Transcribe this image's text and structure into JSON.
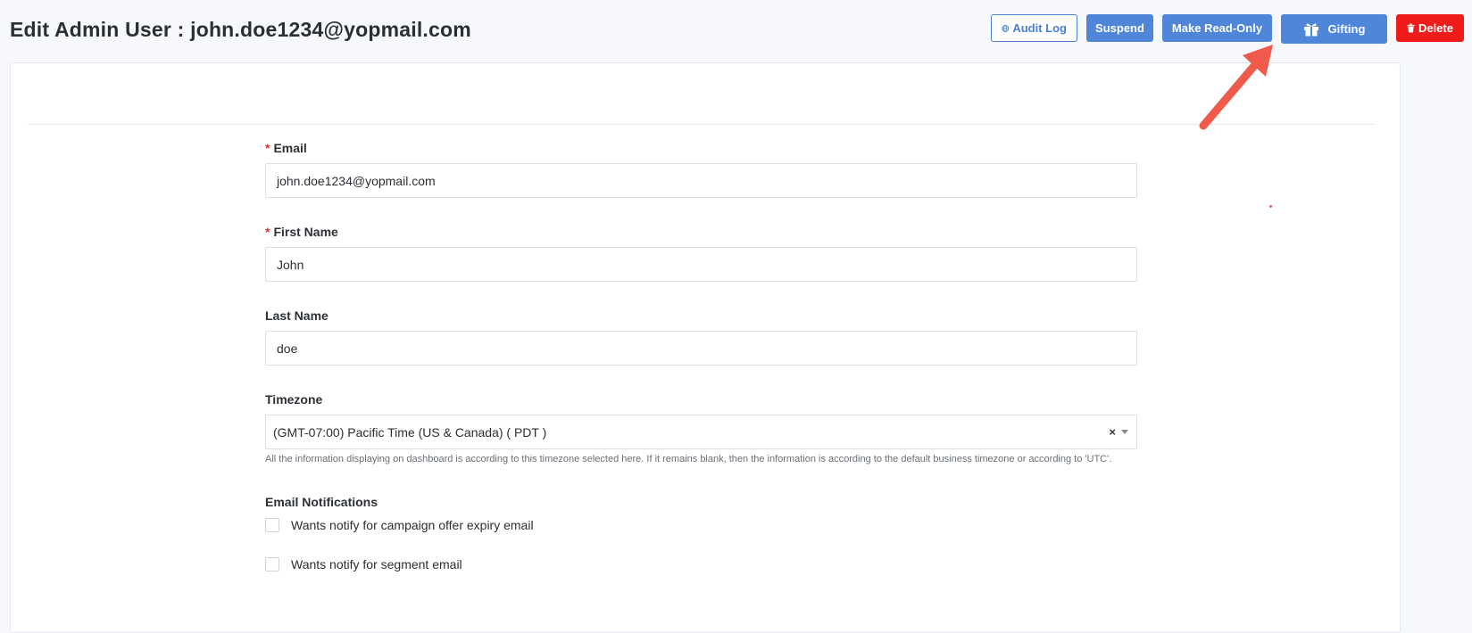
{
  "header": {
    "title": "Edit Admin User : john.doe1234@yopmail.com",
    "buttons": {
      "audit_log": "Audit Log",
      "suspend": "Suspend",
      "read_only": "Make Read-Only",
      "gifting": "Gifting",
      "delete": "Delete"
    }
  },
  "form": {
    "email": {
      "label": "Email",
      "value": "john.doe1234@yopmail.com",
      "required": true
    },
    "first_name": {
      "label": "First Name",
      "value": "John",
      "required": true
    },
    "last_name": {
      "label": "Last Name",
      "value": "doe",
      "required": false
    },
    "timezone": {
      "label": "Timezone",
      "value": "(GMT-07:00) Pacific Time (US & Canada) ( PDT )",
      "clear": "×",
      "help": "All the information displaying on dashboard is according to this timezone selected here. If it remains blank, then the information is according to the default business timezone or according to 'UTC'."
    },
    "notifications": {
      "label": "Email Notifications",
      "options": [
        {
          "label": "Wants notify for campaign offer expiry email",
          "checked": false
        },
        {
          "label": "Wants notify for segment email",
          "checked": false
        }
      ]
    },
    "required_marker": "*"
  },
  "colors": {
    "primary": "#4f86d9",
    "danger": "#f01b1b",
    "annotation_arrow": "#f05a4a"
  },
  "icons": [
    "globe-icon",
    "gift-icon",
    "trash-icon",
    "annotation-arrow"
  ]
}
